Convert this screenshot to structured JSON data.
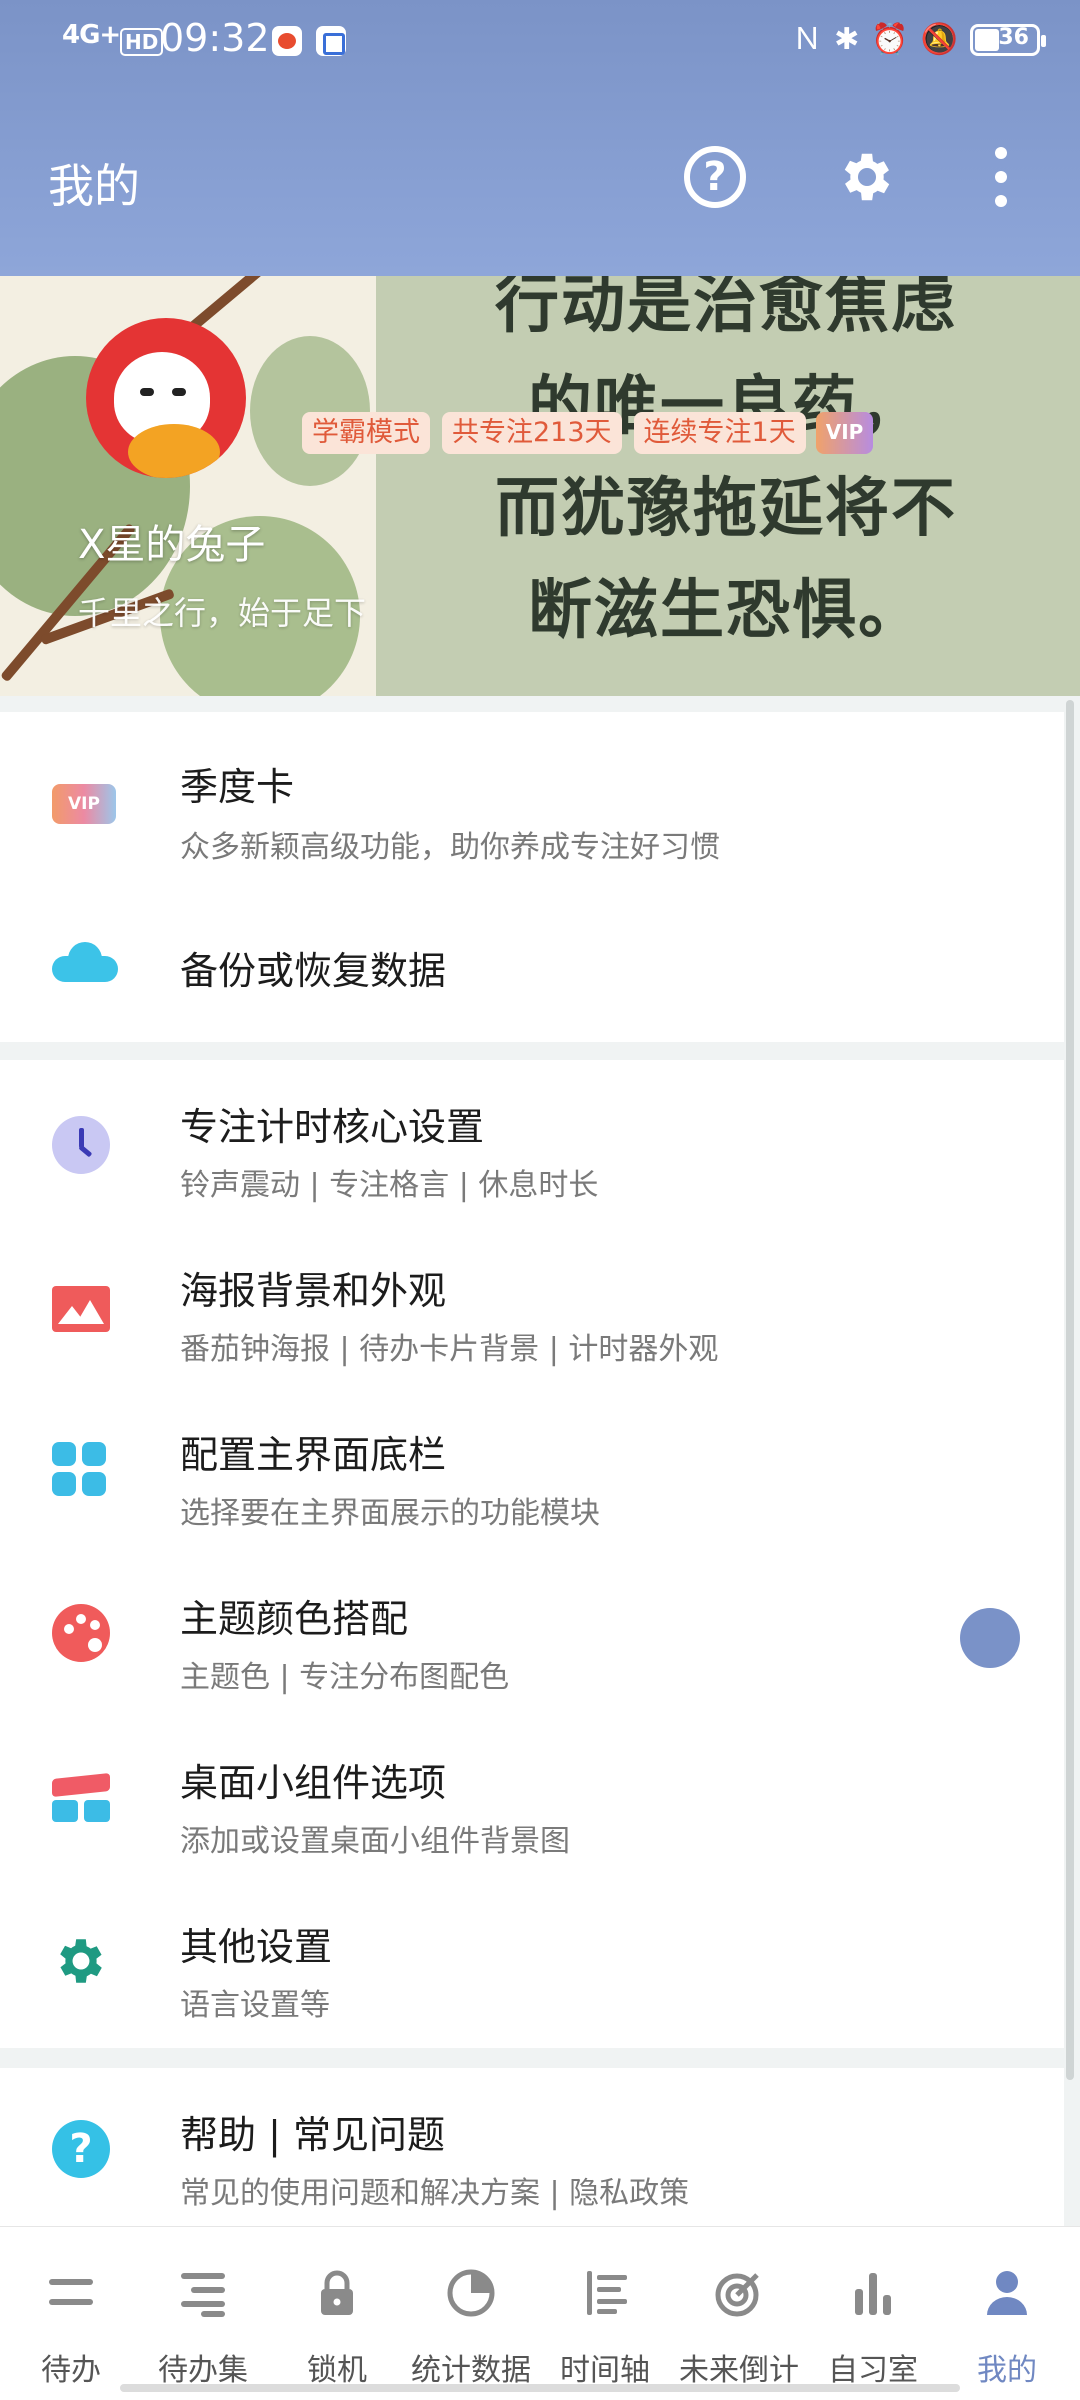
{
  "status_bar": {
    "network": "4G+",
    "hd": "HD",
    "time": "09:32",
    "battery": "36"
  },
  "header": {
    "title": "我的"
  },
  "profile": {
    "badges": [
      "学霸模式",
      "共专注213天",
      "连续专注1天"
    ],
    "vip_label": "VIP",
    "username": "X星的兔子",
    "motto": "千里之行，始于足下",
    "banner_quote_lines": [
      "行动是治愈焦虑",
      "的唯一良药，",
      "而犹豫拖延将不",
      "断滋生恐惧。"
    ]
  },
  "sections": [
    {
      "items": [
        {
          "icon": "vip-icon",
          "title": "季度卡",
          "subtitle": "众多新颖高级功能，助你养成专注好习惯"
        },
        {
          "icon": "cloud-icon",
          "title": "备份或恢复数据",
          "subtitle": ""
        }
      ]
    },
    {
      "items": [
        {
          "icon": "clock-icon",
          "title": "专注计时核心设置",
          "subtitle": "铃声震动 | 专注格言 | 休息时长"
        },
        {
          "icon": "picture-icon",
          "title": "海报背景和外观",
          "subtitle": "番茄钟海报 | 待办卡片背景 | 计时器外观"
        },
        {
          "icon": "grid-icon",
          "title": "配置主界面底栏",
          "subtitle": "选择要在主界面展示的功能模块"
        },
        {
          "icon": "palette-icon",
          "title": "主题颜色搭配",
          "subtitle": "主题色 | 专注分布图配色"
        },
        {
          "icon": "widget-icon",
          "title": "桌面小组件选项",
          "subtitle": "添加或设置桌面小组件背景图"
        },
        {
          "icon": "gear-icon",
          "title": "其他设置",
          "subtitle": "语言设置等"
        }
      ]
    },
    {
      "items": [
        {
          "icon": "help-icon",
          "title": "帮助 | 常见问题",
          "subtitle": "常见的使用问题和解决方案 | 隐私政策"
        }
      ]
    }
  ],
  "vip_icon_text": "VIP",
  "bottom_nav": [
    {
      "icon": "todo-icon",
      "label": "待办"
    },
    {
      "icon": "todo-set-icon",
      "label": "待办集"
    },
    {
      "icon": "lock-icon",
      "label": "锁机"
    },
    {
      "icon": "pie-chart-icon",
      "label": "统计数据"
    },
    {
      "icon": "timeline-icon",
      "label": "时间轴"
    },
    {
      "icon": "target-icon",
      "label": "未来倒计"
    },
    {
      "icon": "bar-chart-icon",
      "label": "自习室"
    },
    {
      "icon": "person-icon",
      "label": "我的",
      "active": true
    }
  ],
  "colors": {
    "header": "#7b93c7",
    "accent": "#7088c2",
    "badge_text": "#e05a3a",
    "float_button": "#7a92c8"
  }
}
